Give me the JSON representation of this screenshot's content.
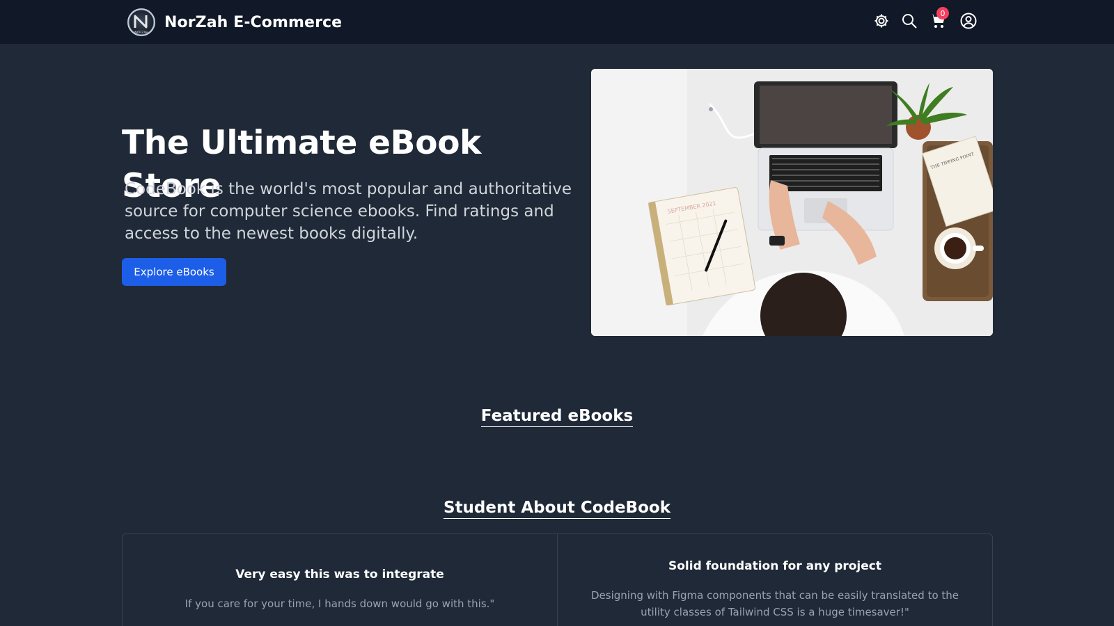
{
  "header": {
    "brand_name": "NorZah E-Commerce",
    "logo_letter": "N",
    "logo_caption": "NORZAH",
    "icons": [
      "gear-icon",
      "search-icon",
      "cart-icon",
      "user-icon"
    ],
    "cart_count": "0"
  },
  "hero": {
    "title": "The Ultimate eBook Store",
    "description": "CodeBook is the world's most popular and authoritative source for computer science ebooks. Find ratings and access to the newest books digitally.",
    "cta_label": "Explore eBooks",
    "calendar_header": "SEPTEMBER 2021",
    "book_title": "THE TIPPING POINT"
  },
  "featured": {
    "title": "Featured eBooks"
  },
  "testimonials": {
    "title": "Student About CodeBook",
    "items": [
      {
        "heading": "Very easy this was to integrate",
        "quote": "If you care for your time, I hands down would go with this.\""
      },
      {
        "heading": "Solid foundation for any project",
        "quote": "Designing with Figma components that can be easily translated to the utility classes of Tailwind CSS is a huge timesaver!\""
      }
    ]
  },
  "colors": {
    "page_bg": "#1f2937",
    "header_bg": "#111827",
    "button_bg": "#1d5ee8",
    "badge_bg": "#f43f5e"
  }
}
